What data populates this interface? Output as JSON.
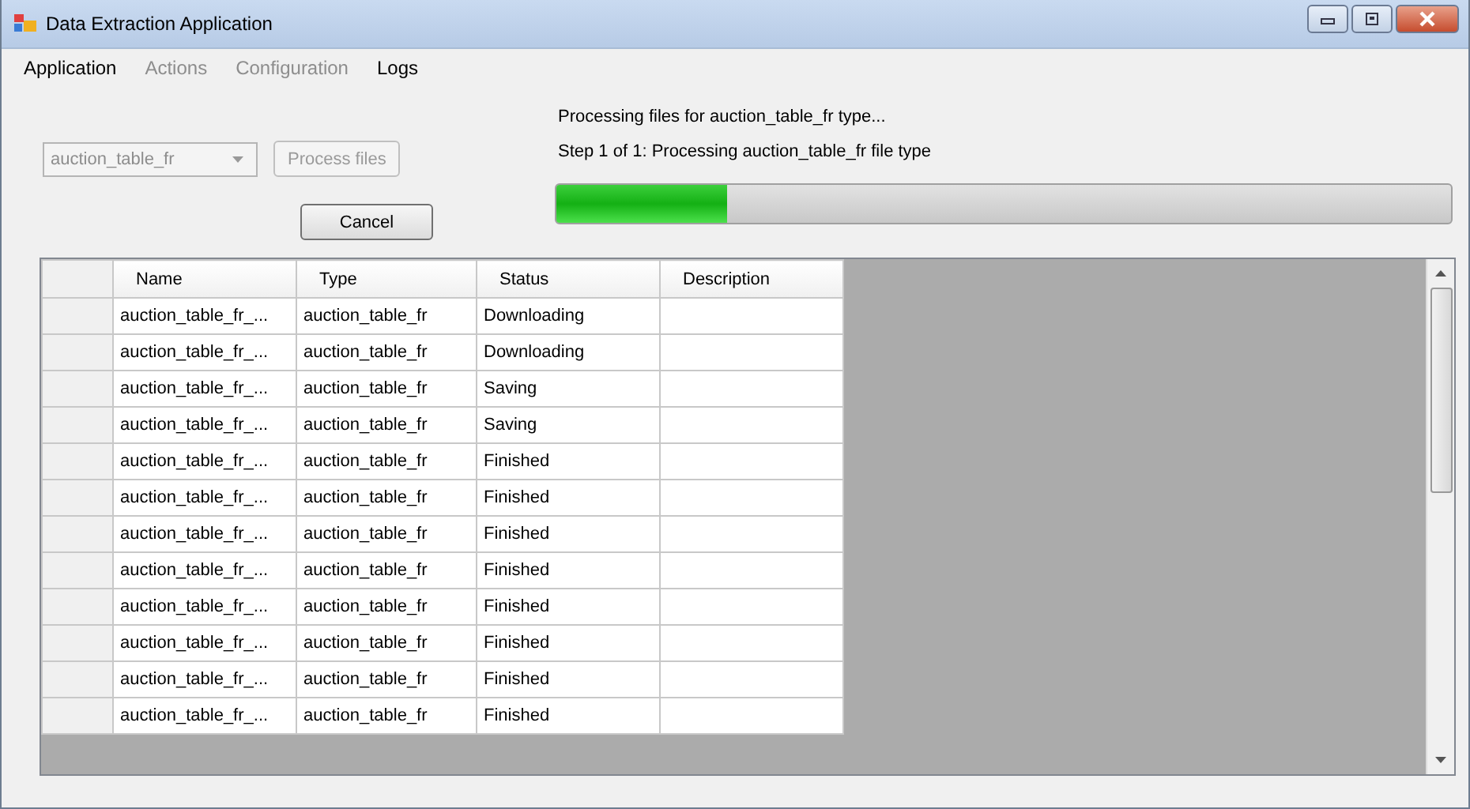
{
  "window": {
    "title": "Data Extraction Application"
  },
  "menu": [
    {
      "label": "Application",
      "disabled": false
    },
    {
      "label": "Actions",
      "disabled": true
    },
    {
      "label": "Configuration",
      "disabled": true
    },
    {
      "label": "Logs",
      "disabled": false
    }
  ],
  "file_type_dropdown": {
    "value": "auction_table_fr",
    "disabled": true
  },
  "process_button": {
    "label": "Process files",
    "disabled": true
  },
  "cancel_button": {
    "label": "Cancel",
    "disabled": false
  },
  "status_lines": [
    "Processing files for auction_table_fr type...",
    "Step 1 of 1: Processing auction_table_fr file type"
  ],
  "progress": {
    "level": 0.19
  },
  "table": {
    "columns": [
      "Name",
      "Type",
      "Status",
      "Description"
    ],
    "rows": [
      [
        "auction_table_fr_...",
        "auction_table_fr",
        "Downloading",
        ""
      ],
      [
        "auction_table_fr_...",
        "auction_table_fr",
        "Downloading",
        ""
      ],
      [
        "auction_table_fr_...",
        "auction_table_fr",
        "Saving",
        ""
      ],
      [
        "auction_table_fr_...",
        "auction_table_fr",
        "Saving",
        ""
      ],
      [
        "auction_table_fr_...",
        "auction_table_fr",
        "Finished",
        ""
      ],
      [
        "auction_table_fr_...",
        "auction_table_fr",
        "Finished",
        ""
      ],
      [
        "auction_table_fr_...",
        "auction_table_fr",
        "Finished",
        ""
      ],
      [
        "auction_table_fr_...",
        "auction_table_fr",
        "Finished",
        ""
      ],
      [
        "auction_table_fr_...",
        "auction_table_fr",
        "Finished",
        ""
      ],
      [
        "auction_table_fr_...",
        "auction_table_fr",
        "Finished",
        ""
      ],
      [
        "auction_table_fr_...",
        "auction_table_fr",
        "Finished",
        ""
      ],
      [
        "auction_table_fr_...",
        "auction_table_fr",
        "Finished",
        ""
      ]
    ]
  }
}
